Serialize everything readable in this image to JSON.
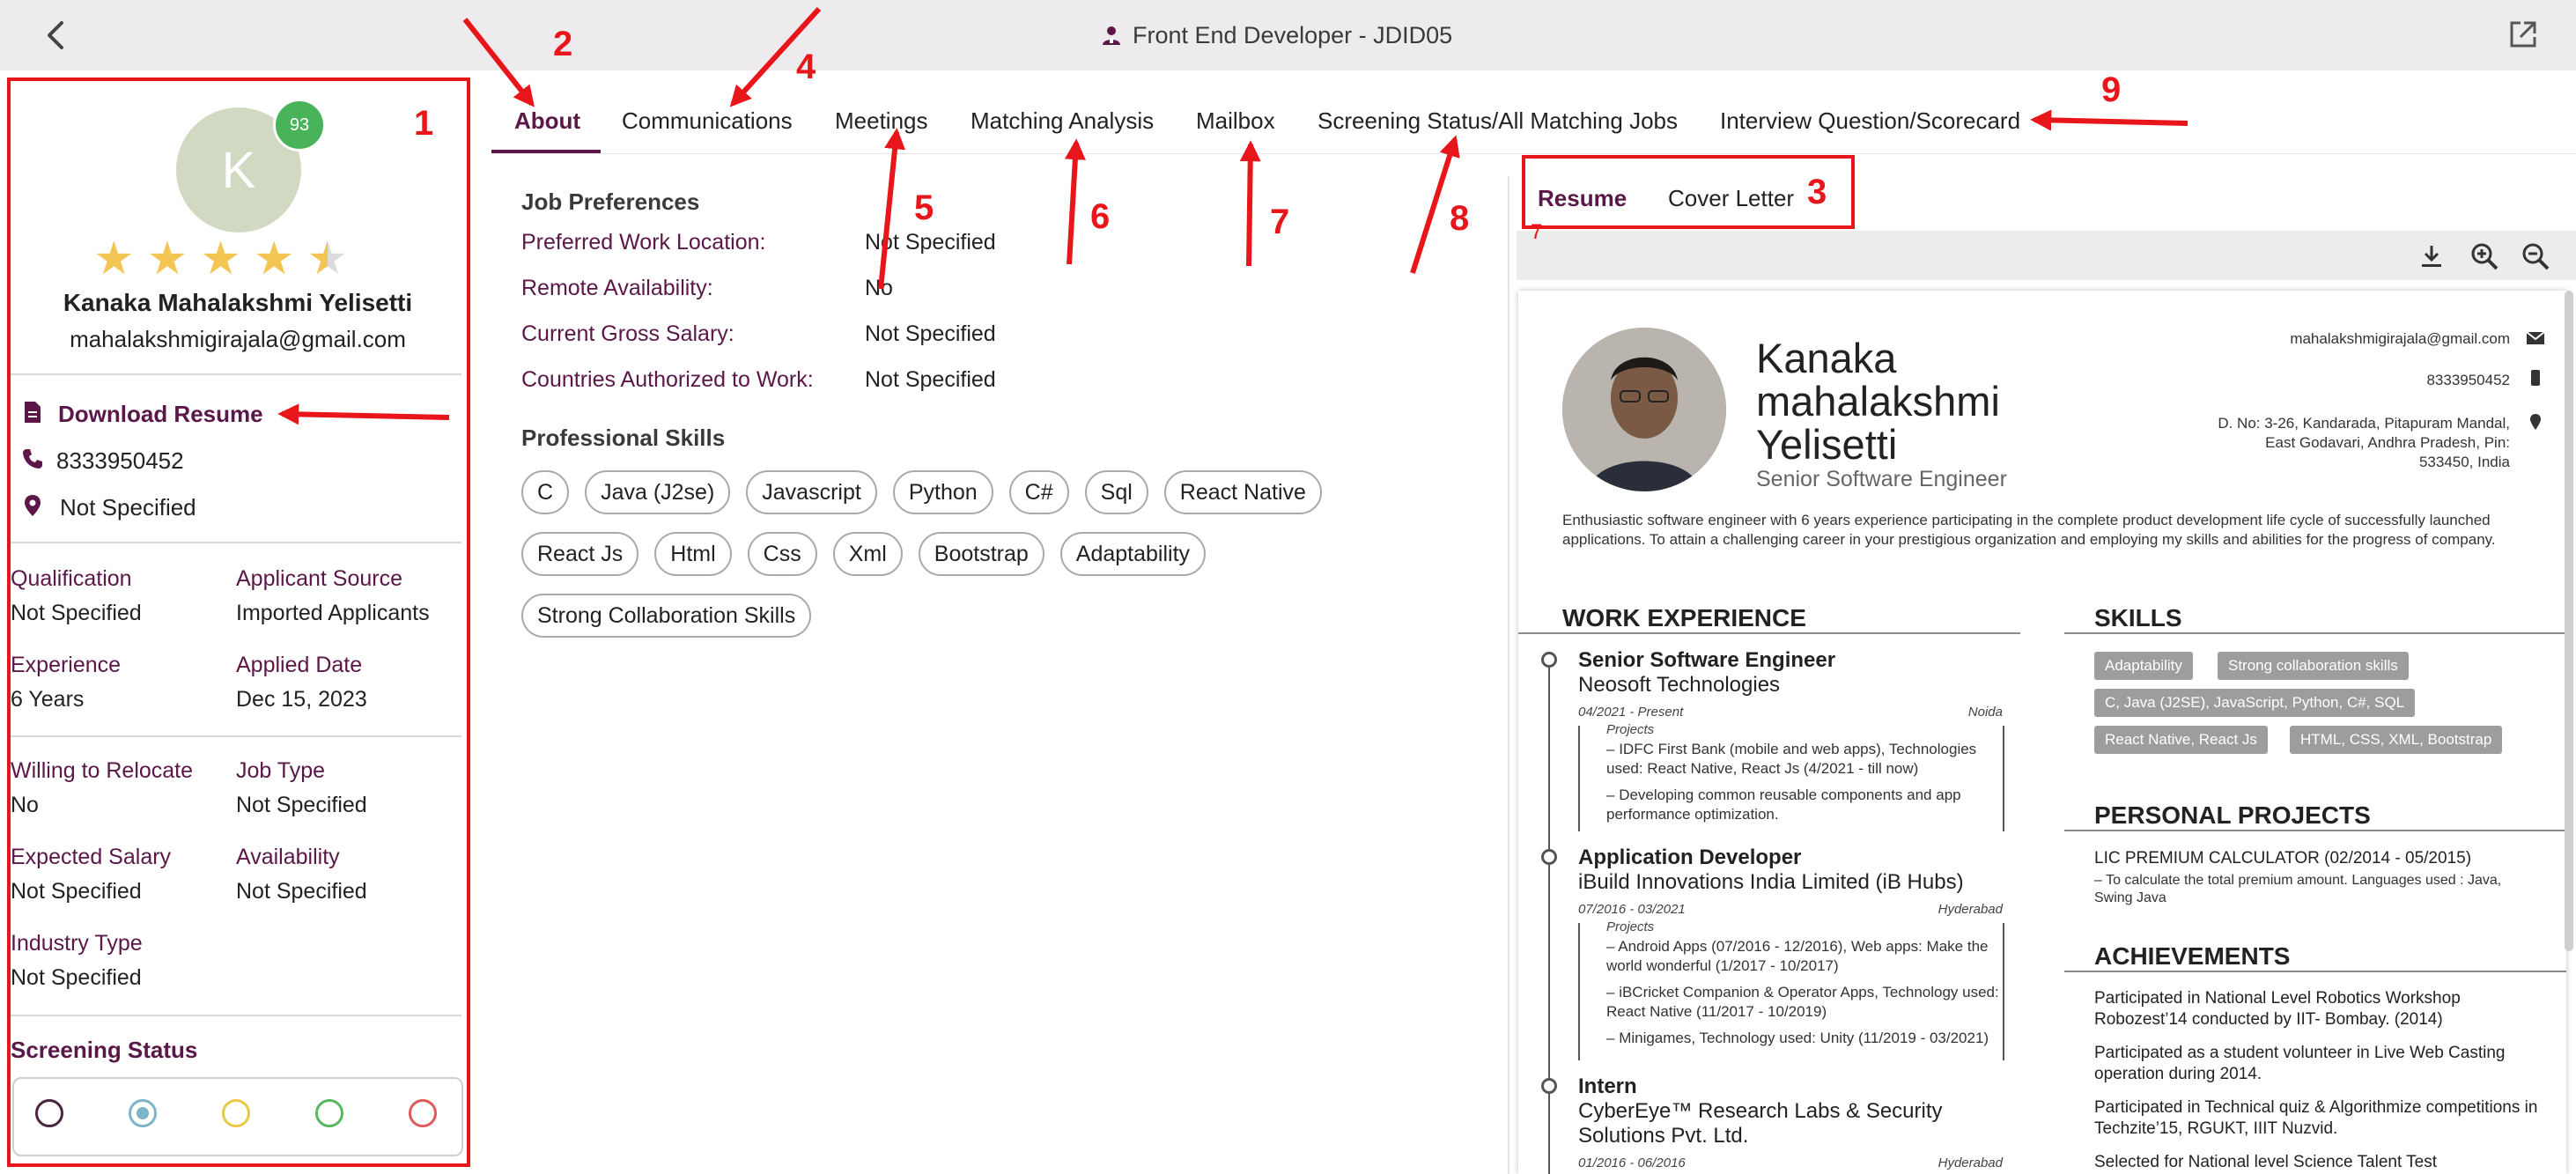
{
  "header": {
    "title": "Front End Developer - JDID05"
  },
  "candidate": {
    "avatar_initial": "K",
    "match_score": "93",
    "rating": 4.5,
    "name": "Kanaka Mahalakshmi Yelisetti",
    "email": "mahalakshmigirajala@gmail.com",
    "download_resume": "Download Resume",
    "phone": "8333950452",
    "location": "Not Specified",
    "details": [
      {
        "label": "Qualification",
        "value": "Not Specified"
      },
      {
        "label": "Applicant Source",
        "value": "Imported Applicants"
      },
      {
        "label": "Experience",
        "value": "6 Years"
      },
      {
        "label": "Applied Date",
        "value": "Dec 15, 2023"
      },
      {
        "label": "Willing to Relocate",
        "value": "No"
      },
      {
        "label": "Job Type",
        "value": "Not Specified"
      },
      {
        "label": "Expected Salary",
        "value": "Not Specified"
      },
      {
        "label": "Availability",
        "value": "Not Specified"
      },
      {
        "label": "Industry Type",
        "value": "Not Specified"
      }
    ],
    "screening_status_title": "Screening Status",
    "screening_colors": [
      "#4a2541",
      "#7fb3c9",
      "#e8c84a",
      "#58b85e",
      "#e05a5a"
    ]
  },
  "tabs": [
    {
      "label": "About"
    },
    {
      "label": "Communications"
    },
    {
      "label": "Meetings"
    },
    {
      "label": "Matching Analysis"
    },
    {
      "label": "Mailbox"
    },
    {
      "label": "Screening Status/All Matching Jobs"
    },
    {
      "label": "Interview Question/Scorecard"
    }
  ],
  "about": {
    "job_preferences_title": "Job Preferences",
    "preferences": [
      {
        "label": "Preferred Work Location:",
        "value": "Not Specified"
      },
      {
        "label": "Remote Availability:",
        "value": "No"
      },
      {
        "label": "Current Gross Salary:",
        "value": "Not Specified"
      },
      {
        "label": "Countries Authorized to Work:",
        "value": "Not Specified"
      }
    ],
    "skills_title": "Professional Skills",
    "skills": [
      "C",
      "Java (J2se)",
      "Javascript",
      "Python",
      "C#",
      "Sql",
      "React Native",
      "React Js",
      "Html",
      "Css",
      "Xml",
      "Bootstrap",
      "Adaptability",
      "Strong Collaboration Skills"
    ]
  },
  "doc_tabs": [
    {
      "label": "Resume"
    },
    {
      "label": "Cover Letter"
    }
  ],
  "resume": {
    "name_line1": "Kanaka",
    "name_line2": "mahalakshmi",
    "name_line3": "Yelisetti",
    "subtitle": "Senior Software Engineer",
    "contact_email": "mahalakshmigirajala@gmail.com",
    "contact_phone": "8333950452",
    "address_line1": "D. No: 3-26, Kandarada, Pitapuram Mandal,",
    "address_line2": "East Godavari, Andhra Pradesh, Pin:",
    "address_line3": "533450, India",
    "summary": "Enthusiastic software engineer with 6 years experience participating in the complete product development life cycle of successfully launched applications. To attain a challenging career in your prestigious organization and employing my skills and abilities for the progress of company.",
    "work_title": "WORK EXPERIENCE",
    "jobs": [
      {
        "title": "Senior Software Engineer",
        "company": "Neosoft Technologies",
        "dates": "04/2021 - Present",
        "city": "Noida",
        "projects_label": "Projects",
        "bullets": [
          "IDFC First Bank (mobile and web apps), Technologies used: React Native, React Js (4/2021 - till now)",
          "Developing common reusable components and app performance optimization."
        ]
      },
      {
        "title": "Application Developer",
        "company": "iBuild Innovations India Limited (iB Hubs)",
        "dates": "07/2016 - 03/2021",
        "city": "Hyderabad",
        "projects_label": "Projects",
        "bullets": [
          "Android Apps (07/2016 - 12/2016), Web apps: Make the world wonderful (1/2017 - 10/2017)",
          "iBCricket Companion & Operator Apps, Technology used: React Native (11/2017 - 10/2019)",
          "Minigames, Technology used: Unity (11/2019 - 03/2021)"
        ]
      },
      {
        "title": "Intern",
        "company_line1": "CyberEye™ Research Labs & Security",
        "company_line2": "Solutions Pvt. Ltd.",
        "dates": "01/2016 - 06/2016",
        "city": "Hyderabad"
      }
    ],
    "skills_title": "SKILLS",
    "skills_tags": [
      "Adaptability",
      "Strong collaboration skills",
      "C, Java (J2SE), JavaScript, Python, C#, SQL",
      "React Native, React Js",
      "HTML, CSS, XML, Bootstrap"
    ],
    "projects_title": "PERSONAL PROJECTS",
    "project_name": "LIC PREMIUM CALCULATOR (02/2014 - 05/2015)",
    "project_desc": "To calculate the total premium amount. Languages used : Java, Swing Java",
    "achievements_title": "ACHIEVEMENTS",
    "achievements": [
      "Participated in National Level Robotics Workshop Robozest’14 conducted by IIT- Bombay. (2014)",
      "Participated as a student volunteer in Live Web Casting operation during 2014.",
      "Participated in Technical quiz & Algorithmize competitions in Techzite’15, RGUKT, IIIT Nuzvid.",
      "Selected for National level Science Talent Test"
    ]
  },
  "annotations": [
    "1",
    "2",
    "3",
    "4",
    "5",
    "6",
    "7",
    "8",
    "9",
    "7"
  ],
  "colors": {
    "accent": "#5a1747",
    "annotation_red": "#e8151b",
    "score_green": "#49b35a",
    "star_gold": "#f3c552",
    "avatar_bg": "#d2d9c2"
  }
}
